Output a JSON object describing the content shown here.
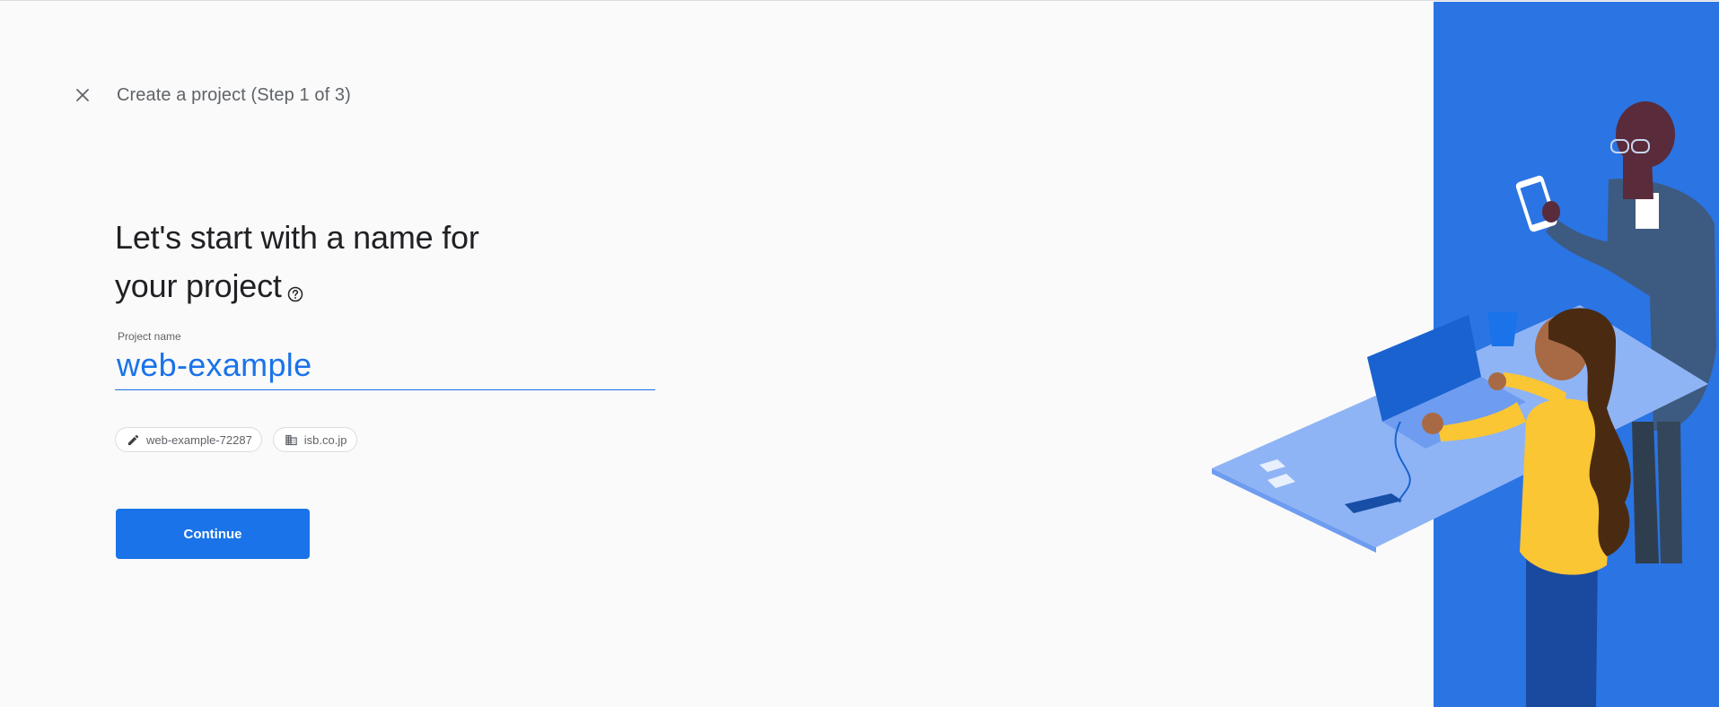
{
  "header": {
    "title": "Create a project (Step 1 of 3)",
    "close_icon": "close-icon"
  },
  "main": {
    "headline_line1": "Let's start with a name for",
    "headline_line2": "your project",
    "help_icon": "help-circle-icon",
    "project_name": {
      "label": "Project name",
      "value": "web-example"
    },
    "chips": [
      {
        "icon": "pencil-icon",
        "label": "web-example-72287"
      },
      {
        "icon": "organization-icon",
        "label": "isb.co.jp"
      }
    ],
    "continue_label": "Continue"
  },
  "colors": {
    "accent": "#1a73e8",
    "illustration_bg": "#2b74e3",
    "text_primary": "#202124",
    "text_secondary": "#5f6368"
  }
}
